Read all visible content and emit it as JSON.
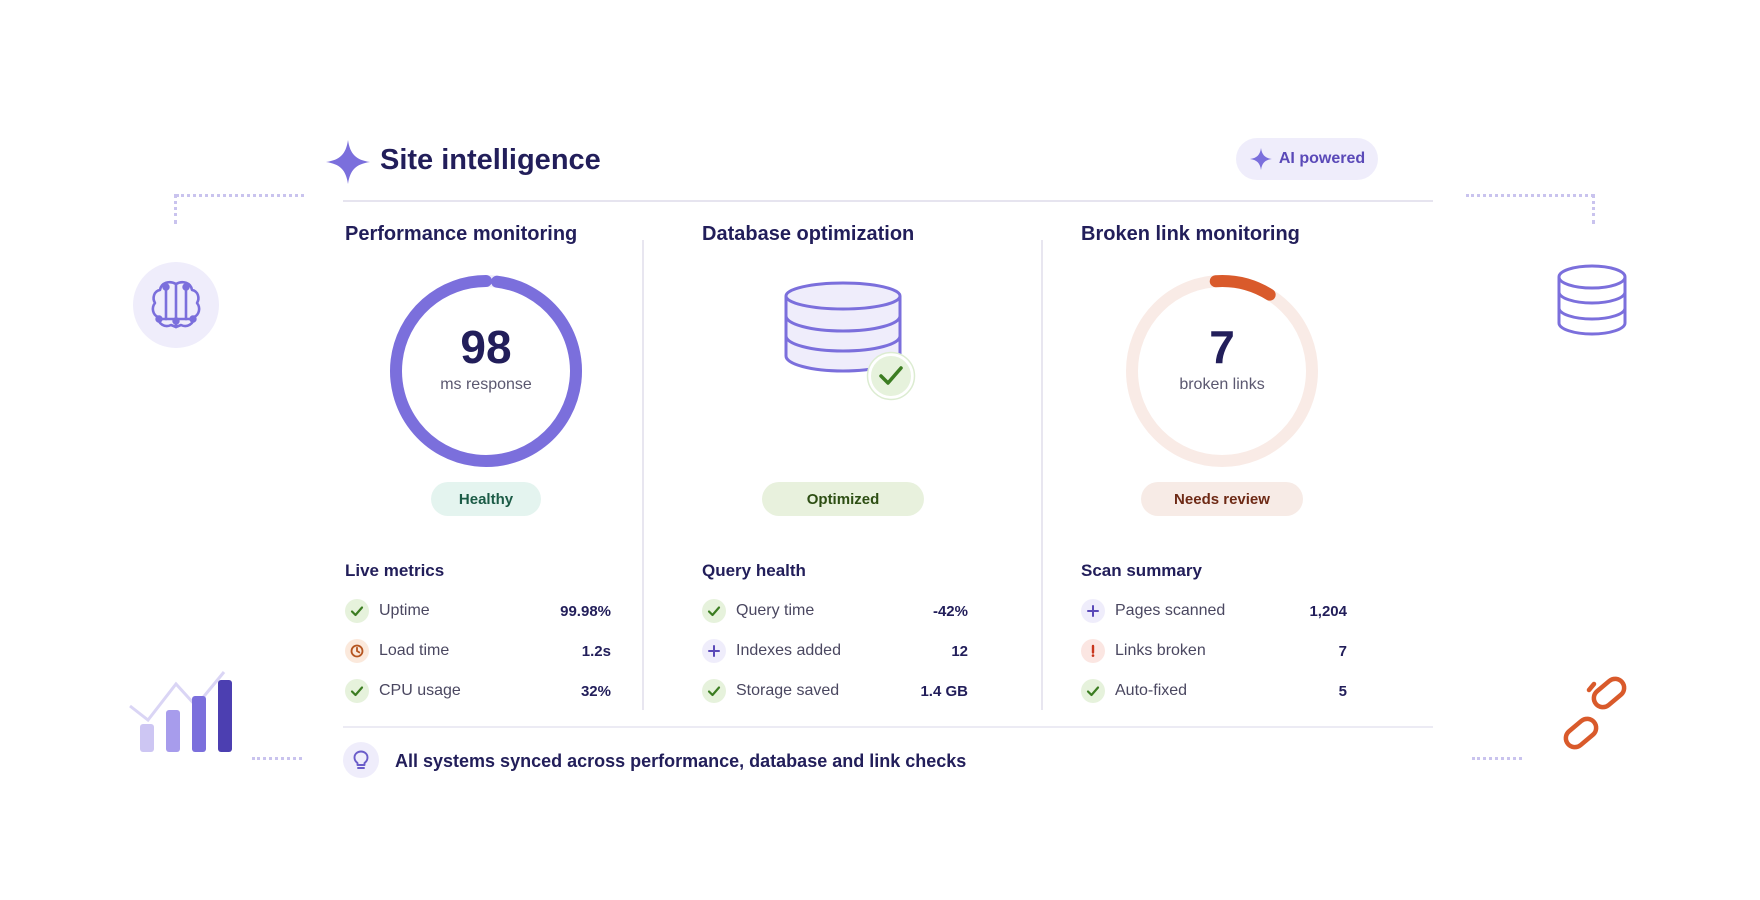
{
  "header": {
    "title": "Site intelligence",
    "badge": "AI powered",
    "star_icon": "sparkle-icon"
  },
  "colors": {
    "accent": "#7b6fdc",
    "accent_dark": "#5a49b8",
    "ink": "#221e5a",
    "warning": "#d95a2b",
    "success": "#3c7d22"
  },
  "columns": [
    {
      "title": "Performance monitoring",
      "gauge": {
        "value": "98",
        "unit": "ms response",
        "fill_fraction": 0.98
      },
      "status": "Healthy",
      "section": "Live metrics",
      "metrics": [
        {
          "label": "Uptime",
          "value": "99.98%",
          "icon": "check-icon"
        },
        {
          "label": "Load time",
          "value": "1.2s",
          "icon": "clock-icon"
        },
        {
          "label": "CPU usage",
          "value": "32%",
          "icon": "check-icon"
        }
      ]
    },
    {
      "title": "Database optimization",
      "illustration": "database-check-icon",
      "status": "Optimized",
      "section": "Query health",
      "metrics": [
        {
          "label": "Query time",
          "value": "-42%",
          "icon": "check-icon"
        },
        {
          "label": "Indexes added",
          "value": "12",
          "icon": "plus-icon"
        },
        {
          "label": "Storage saved",
          "value": "1.4 GB",
          "icon": "check-icon"
        }
      ]
    },
    {
      "title": "Broken link monitoring",
      "gauge": {
        "value": "7",
        "unit": "broken links",
        "fill_fraction": 0.1
      },
      "status": "Needs review",
      "section": "Scan summary",
      "metrics": [
        {
          "label": "Pages scanned",
          "value": "1,204",
          "icon": "plus-icon"
        },
        {
          "label": "Links broken",
          "value": "7",
          "icon": "alert-icon"
        },
        {
          "label": "Auto-fixed",
          "value": "5",
          "icon": "check-icon"
        }
      ]
    }
  ],
  "footer": {
    "text": "All systems synced across performance, database and link checks",
    "icon": "lightbulb-icon"
  },
  "decorations": [
    "brain-icon",
    "bar-chart-icon",
    "database-icon",
    "broken-link-icon"
  ]
}
